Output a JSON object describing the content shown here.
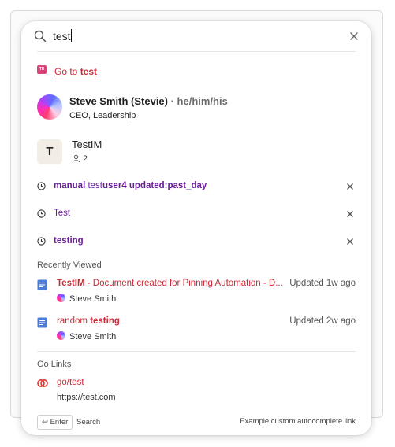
{
  "search": {
    "value": "test",
    "clear_icon": "close-icon",
    "search_icon": "search-icon"
  },
  "goto": {
    "badge": "TE",
    "prefix": "Go to ",
    "term": "test"
  },
  "person": {
    "name": "Steve Smith (Stevie)",
    "pronouns": " · he/him/his",
    "title": "CEO, Leadership"
  },
  "group": {
    "initial": "T",
    "name": "TestIM",
    "member_count": "2"
  },
  "history": [
    {
      "parts": [
        "manual ",
        "test",
        "user4 updated:past_day"
      ],
      "bold": [
        true,
        false,
        true
      ]
    },
    {
      "parts": [
        "Test"
      ],
      "bold": [
        false
      ]
    },
    {
      "parts": [
        "testing"
      ],
      "bold": [
        true
      ]
    }
  ],
  "recently_viewed": {
    "label": "Recently Viewed",
    "items": [
      {
        "title_bold": "TestIM",
        "title_rest": " - Document created for Pinning Automation - D...",
        "updated": "Updated 1w ago",
        "author": "Steve Smith"
      },
      {
        "title_rest": "random ",
        "title_bold": "testing",
        "updated": "Updated 2w ago",
        "author": "Steve Smith"
      }
    ]
  },
  "go_links": {
    "label": "Go Links",
    "items": [
      {
        "name": "go/test",
        "url": "https://test.com"
      }
    ]
  },
  "footer": {
    "enter_key": "↩ Enter",
    "action": "Search",
    "hint": "Example custom autocomplete link"
  },
  "colors": {
    "accent_red": "#cc2936",
    "history_purple": "#6a1b9a",
    "doc_blue": "#4a7bd8",
    "golink_red": "#e0322f"
  }
}
